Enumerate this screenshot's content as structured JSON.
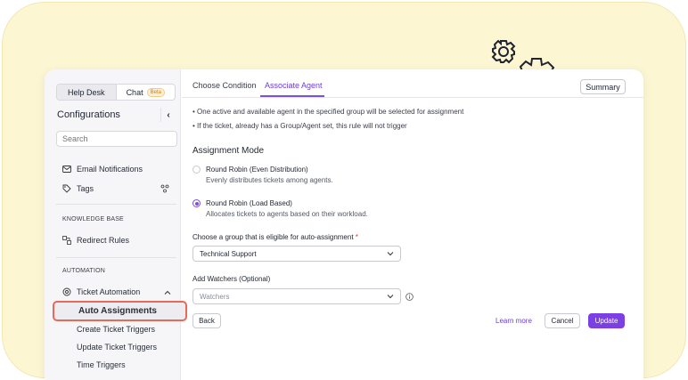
{
  "sidebar": {
    "segment": {
      "help_desk": "Help Desk",
      "chat": "Chat",
      "chat_badge": "Beta"
    },
    "title": "Configurations",
    "collapse_glyph": "‹",
    "search_placeholder": "Search",
    "items": {
      "email_notifications": "Email Notifications",
      "tags": "Tags",
      "knowledge_base_label": "KNOWLEDGE BASE",
      "redirect_rules": "Redirect Rules",
      "automation_label": "AUTOMATION",
      "ticket_automation": "Ticket Automation",
      "auto_assignments": "Auto Assignments",
      "create_ticket_triggers": "Create Ticket Triggers",
      "update_ticket_triggers": "Update Ticket Triggers",
      "time_triggers": "Time Triggers"
    }
  },
  "main": {
    "tabs": {
      "choose_condition": "Choose Condition",
      "associate_agent": "Associate Agent"
    },
    "summary_button": "Summary",
    "bullets": [
      "One active and available agent in the specified group will be selected for assignment",
      "If the ticket, already has a Group/Agent set, this rule will not trigger"
    ],
    "assignment_mode_title": "Assignment Mode",
    "options": [
      {
        "title": "Round Robin (Even Distribution)",
        "desc": "Evenly distributes tickets among agents.",
        "selected": false
      },
      {
        "title": "Round Robin (Load Based)",
        "desc": "Allocates tickets to agents based on their workload.",
        "selected": true
      }
    ],
    "group_label": "Choose a group that is eligible for auto-assignment",
    "group_required_mark": "*",
    "group_value": "Technical Support",
    "watchers_label": "Add Watchers (Optional)",
    "watchers_placeholder": "Watchers",
    "back_button": "Back",
    "learn_more": "Learn more",
    "cancel_button": "Cancel",
    "update_button": "Update"
  },
  "colors": {
    "accent": "#7b3fe4",
    "highlight_border": "#e66a5a",
    "background_blob": "#fdf6d3"
  }
}
